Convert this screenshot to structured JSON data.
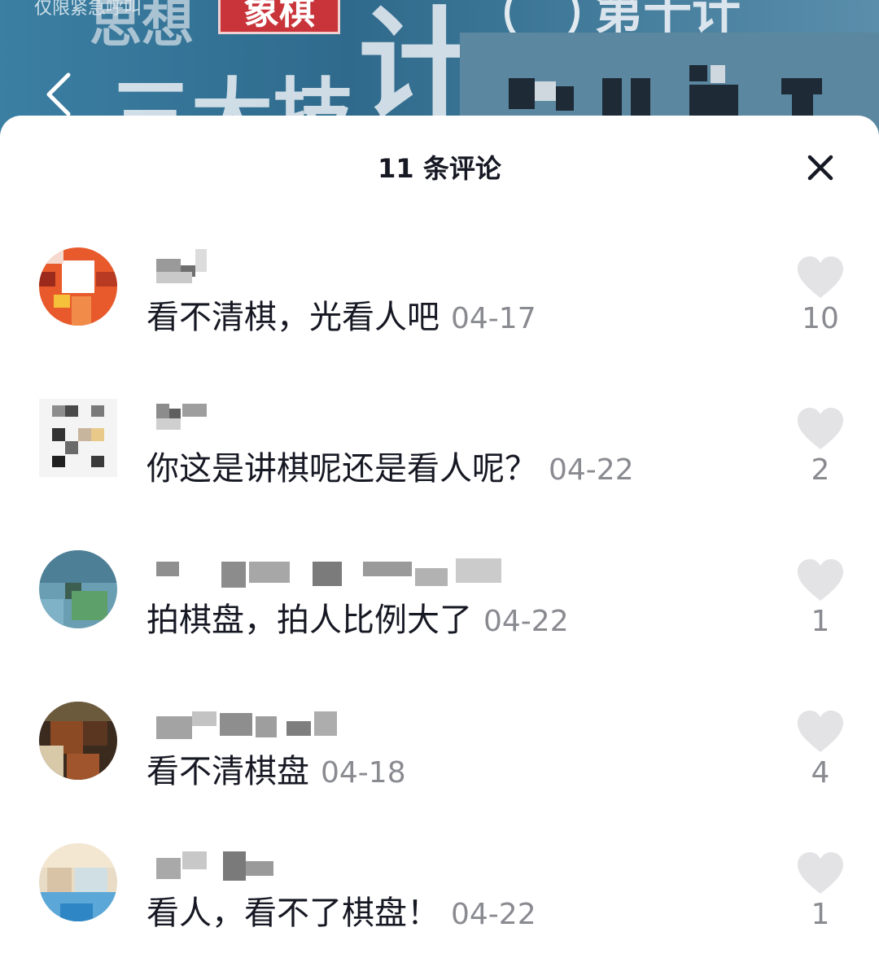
{
  "backdrop": {
    "overlay_text": "仅限紧急呼叫",
    "banner_label": "象棋",
    "glyph_top": "思想",
    "glyph_left": "三大技",
    "glyph_tall": "计",
    "glyph_right": "第十计"
  },
  "header": {
    "title": "11 条评论",
    "close_icon": "close-icon"
  },
  "comments": [
    {
      "text": "看不清棋，光看人吧",
      "date": "04-17",
      "likes": "10"
    },
    {
      "text": "你这是讲棋呢还是看人呢？",
      "date": "04-22",
      "likes": "2"
    },
    {
      "text": "拍棋盘，拍人比例大了",
      "date": "04-22",
      "likes": "1"
    },
    {
      "text": "看不清棋盘",
      "date": "04-18",
      "likes": "4"
    },
    {
      "text": "看人，看不了棋盘！",
      "date": "04-22",
      "likes": "1"
    }
  ],
  "colors": {
    "text_primary": "#161823",
    "text_secondary": "#8a8b91",
    "heart": "#e3e3e6"
  }
}
